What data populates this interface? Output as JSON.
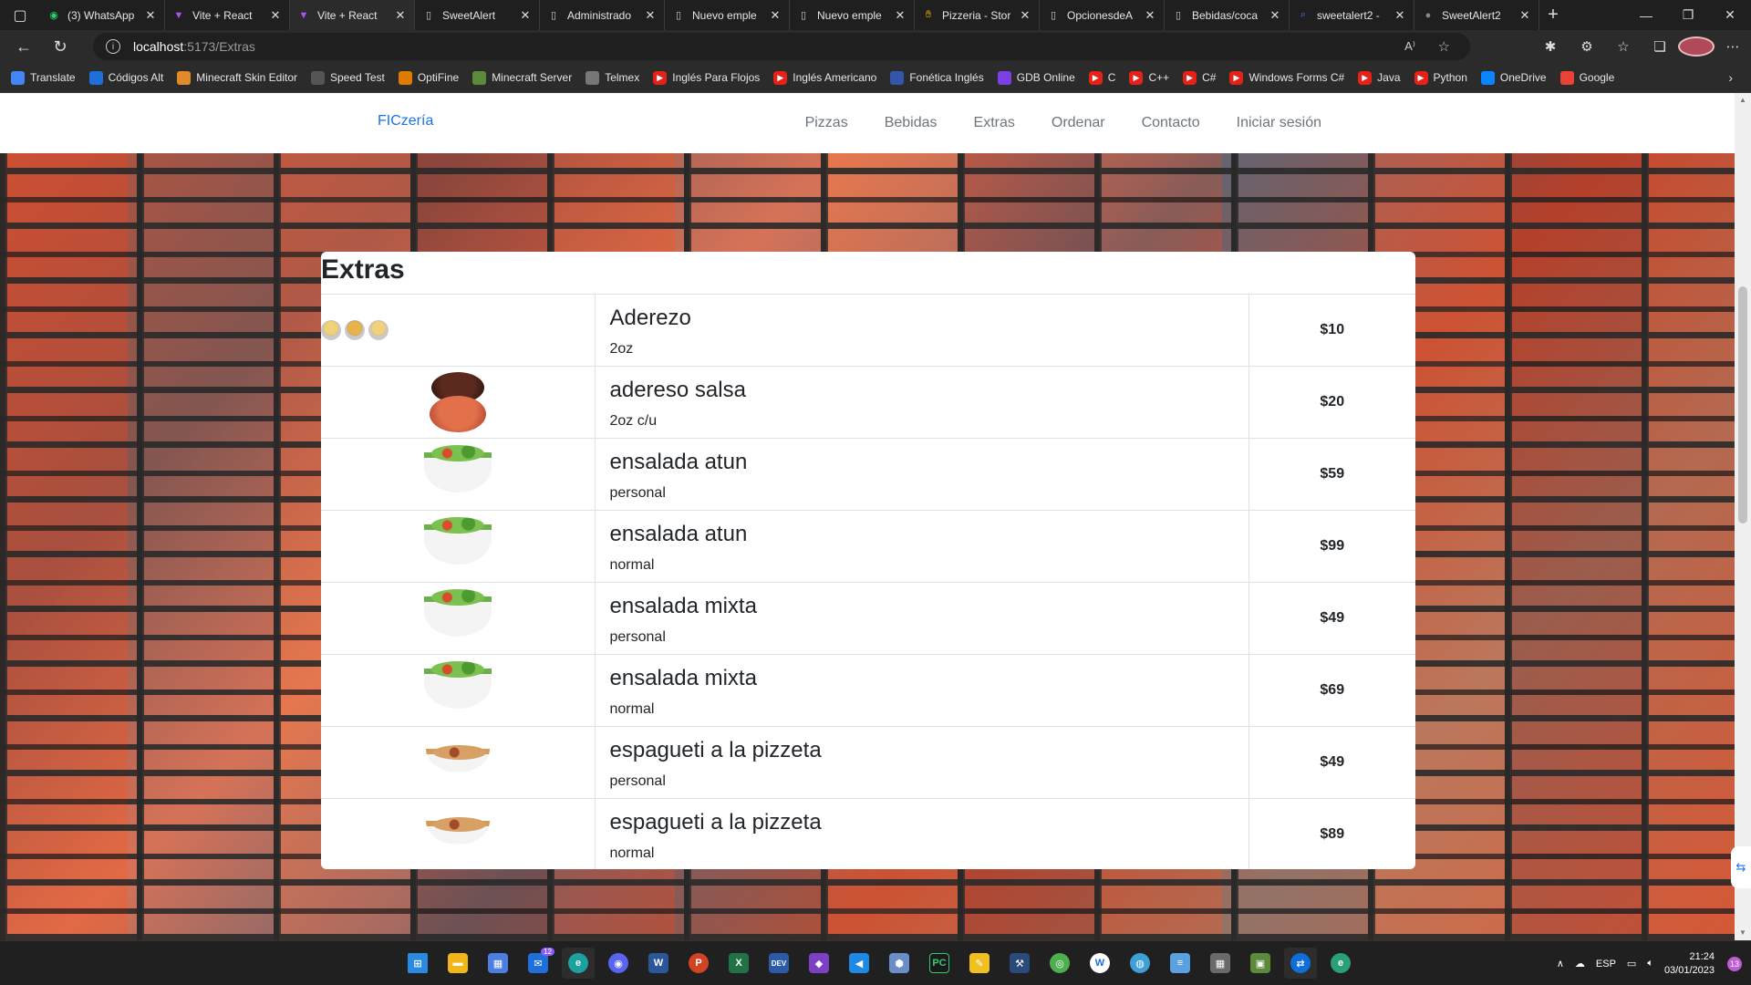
{
  "tabs": [
    {
      "title": "(3) WhatsApp",
      "icon": "whatsapp-icon",
      "color": "#25d366",
      "active": false
    },
    {
      "title": "Vite + React",
      "icon": "vite-icon",
      "color": "#a855f7",
      "active": false
    },
    {
      "title": "Vite + React",
      "icon": "vite-icon",
      "color": "#a855f7",
      "active": true
    },
    {
      "title": "SweetAlert",
      "icon": "page-icon",
      "color": "#cccccc",
      "active": false
    },
    {
      "title": "Administrado",
      "icon": "page-icon",
      "color": "#cccccc",
      "active": false
    },
    {
      "title": "Nuevo emple",
      "icon": "page-icon",
      "color": "#cccccc",
      "active": false
    },
    {
      "title": "Nuevo emple",
      "icon": "page-icon",
      "color": "#cccccc",
      "active": false
    },
    {
      "title": "Pizzeria - Stor",
      "icon": "hand-icon",
      "color": "#f5b400",
      "active": false
    },
    {
      "title": "OpcionesdeA",
      "icon": "page-icon",
      "color": "#cccccc",
      "active": false
    },
    {
      "title": "Bebidas/coca",
      "icon": "page-icon",
      "color": "#cccccc",
      "active": false
    },
    {
      "title": "sweetalert2 -",
      "icon": "search-icon",
      "color": "#3b82f6",
      "active": false
    },
    {
      "title": "SweetAlert2",
      "icon": "github-icon",
      "color": "#888888",
      "active": false
    }
  ],
  "address": {
    "host": "localhost",
    "path": ":5173/Extras"
  },
  "favorites": [
    {
      "label": "Translate",
      "icon": "translate-icon",
      "color": "#4285f4"
    },
    {
      "label": "Códigos Alt",
      "icon": "check-icon",
      "color": "#1e6fd9"
    },
    {
      "label": "Minecraft Skin Editor",
      "icon": "skin-icon",
      "color": "#e08a2a"
    },
    {
      "label": "Speed Test",
      "icon": "speed-icon",
      "color": "#555555"
    },
    {
      "label": "OptiFine",
      "icon": "optifine-icon",
      "color": "#e07a00"
    },
    {
      "label": "Minecraft Server",
      "icon": "cube-icon",
      "color": "#5b8a3a"
    },
    {
      "label": "Telmex",
      "icon": "page-icon",
      "color": "#777777"
    },
    {
      "label": "Inglés Para Flojos",
      "icon": "youtube-icon",
      "color": "#e62117"
    },
    {
      "label": "Inglés Americano",
      "icon": "youtube-icon",
      "color": "#e62117"
    },
    {
      "label": "Fonética Inglés",
      "icon": "r-icon",
      "color": "#3355aa"
    },
    {
      "label": "GDB Online",
      "icon": "bolt-icon",
      "color": "#7b3fe4"
    },
    {
      "label": "C",
      "icon": "youtube-icon",
      "color": "#e62117"
    },
    {
      "label": "C++",
      "icon": "youtube-icon",
      "color": "#e62117"
    },
    {
      "label": "C#",
      "icon": "youtube-icon",
      "color": "#e62117"
    },
    {
      "label": "Windows Forms C#",
      "icon": "youtube-icon",
      "color": "#e62117"
    },
    {
      "label": "Java",
      "icon": "youtube-icon",
      "color": "#e62117"
    },
    {
      "label": "Python",
      "icon": "youtube-icon",
      "color": "#e62117"
    },
    {
      "label": "OneDrive",
      "icon": "cloud-icon",
      "color": "#0a84ff"
    },
    {
      "label": "Google",
      "icon": "google-icon",
      "color": "#ea4335"
    }
  ],
  "site": {
    "brand": "FICzería",
    "brand_color": "#1a73e8",
    "nav": [
      "Pizzas",
      "Bebidas",
      "Extras",
      "Ordenar",
      "Contacto",
      "Iniciar sesión"
    ]
  },
  "extras": {
    "heading": "Extras",
    "items": [
      {
        "name": "Aderezo",
        "desc": "2oz",
        "price": "$10",
        "img": "cups"
      },
      {
        "name": "adereso salsa",
        "desc": "2oz c/u",
        "price": "$20",
        "img": "sauce"
      },
      {
        "name": "ensalada atun",
        "desc": "personal",
        "price": "$59",
        "img": "salad"
      },
      {
        "name": "ensalada atun",
        "desc": "normal",
        "price": "$99",
        "img": "salad"
      },
      {
        "name": "ensalada mixta",
        "desc": "personal",
        "price": "$49",
        "img": "salad"
      },
      {
        "name": "ensalada mixta",
        "desc": "normal",
        "price": "$69",
        "img": "salad"
      },
      {
        "name": "espagueti a la pizzeta",
        "desc": "personal",
        "price": "$49",
        "img": "pasta"
      },
      {
        "name": "espagueti a la pizzeta",
        "desc": "normal",
        "price": "$89",
        "img": "pasta"
      }
    ]
  },
  "taskbar": {
    "mail_badge": "12",
    "language": "ESP",
    "time": "21:24",
    "date": "03/01/2023",
    "notifications": "13"
  }
}
